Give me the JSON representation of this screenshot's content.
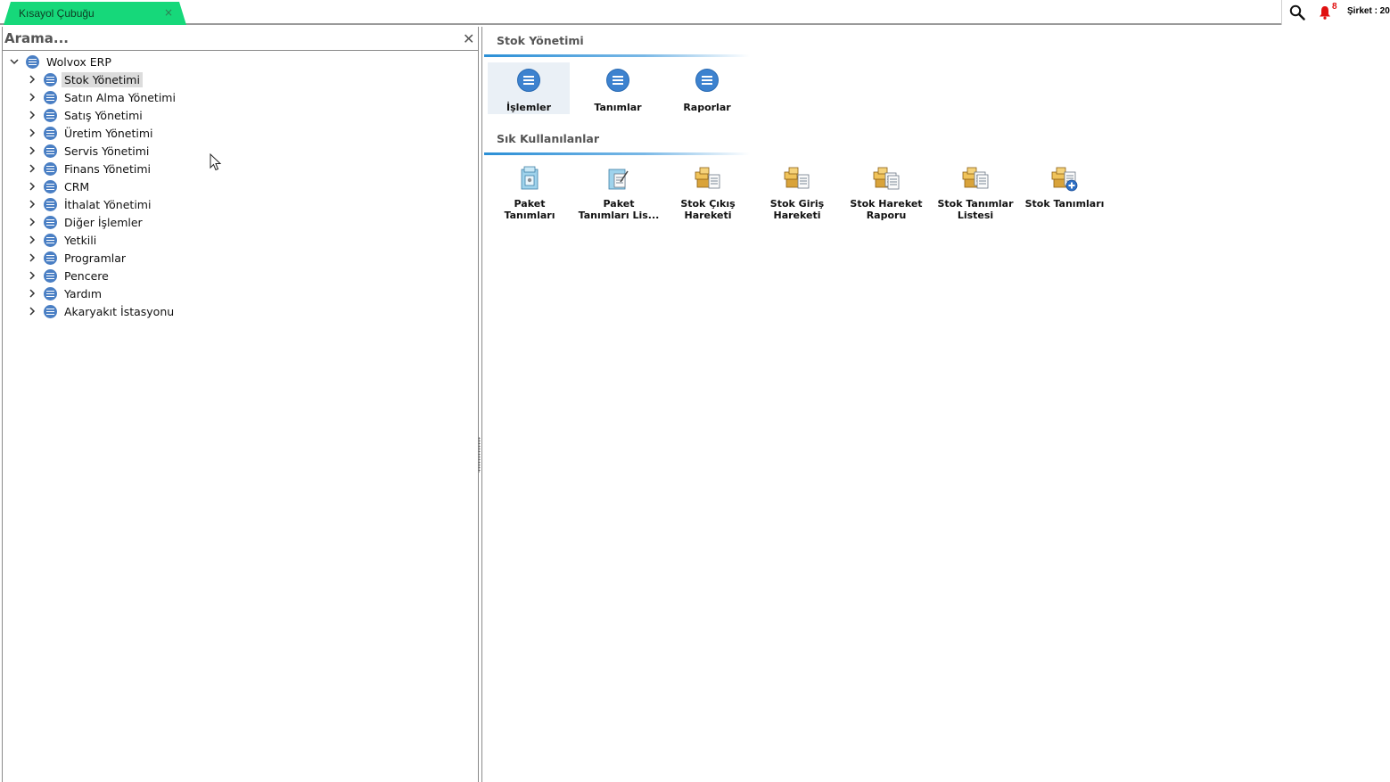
{
  "topbar": {
    "tab_label": "Kısayol Çubuğu",
    "tab_close": "×",
    "notification_count": "8",
    "company_label": "Şirket : 20"
  },
  "search": {
    "placeholder": "Arama...",
    "clear": "✕"
  },
  "tree": {
    "root": "Wolvox ERP",
    "items": [
      {
        "label": "Stok Yönetimi",
        "selected": true
      },
      {
        "label": "Satın Alma Yönetimi"
      },
      {
        "label": "Satış Yönetimi"
      },
      {
        "label": "Üretim Yönetimi"
      },
      {
        "label": "Servis Yönetimi"
      },
      {
        "label": "Finans Yönetimi"
      },
      {
        "label": "CRM"
      },
      {
        "label": "İthalat Yönetimi"
      },
      {
        "label": "Diğer İşlemler"
      },
      {
        "label": "Yetkili"
      },
      {
        "label": "Programlar"
      },
      {
        "label": "Pencere"
      },
      {
        "label": "Yardım"
      },
      {
        "label": "Akaryakıt İstasyonu"
      }
    ]
  },
  "main": {
    "module_title": "Stok Yönetimi",
    "categories": [
      {
        "label": "İşlemler",
        "active": true
      },
      {
        "label": "Tanımlar"
      },
      {
        "label": "Raporlar"
      }
    ],
    "favorites_title": "Sık Kullanılanlar",
    "favorites": [
      {
        "label": "Paket\nTanımları",
        "icon": "package-definitions-icon"
      },
      {
        "label": "Paket\nTanımları Lis...",
        "icon": "package-list-icon"
      },
      {
        "label": "Stok Çıkış\nHareketi",
        "icon": "stock-out-icon"
      },
      {
        "label": "Stok Giriş\nHareketi",
        "icon": "stock-in-icon"
      },
      {
        "label": "Stok Hareket\nRaporu",
        "icon": "stock-report-icon"
      },
      {
        "label": "Stok Tanımlar\nListesi",
        "icon": "stock-list-icon"
      },
      {
        "label": "Stok Tanımları",
        "icon": "stock-add-icon"
      }
    ]
  },
  "colors": {
    "tab_green": "#16d87a",
    "accent_blue": "#3d82cf",
    "bell_red": "#e01010"
  }
}
